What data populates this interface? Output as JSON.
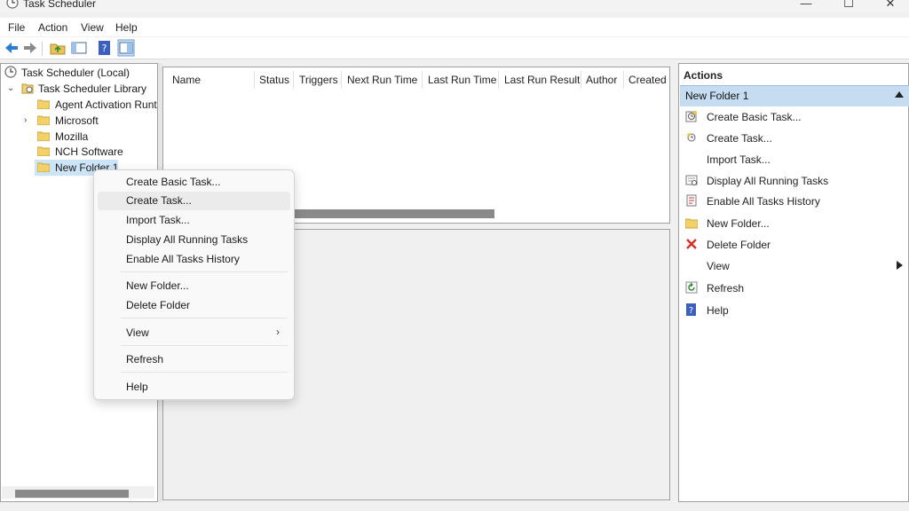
{
  "window": {
    "title": "Task Scheduler"
  },
  "menubar": {
    "items": [
      "File",
      "Action",
      "View",
      "Help"
    ]
  },
  "tree": {
    "root": "Task Scheduler (Local)",
    "library": "Task Scheduler Library",
    "folders": [
      "Agent Activation Runt",
      "Microsoft",
      "Mozilla",
      "NCH Software",
      "New Folder 1"
    ]
  },
  "task_list": {
    "columns": [
      "Name",
      "Status",
      "Triggers",
      "Next Run Time",
      "Last Run Time",
      "Last Run Result",
      "Author",
      "Created"
    ]
  },
  "actions": {
    "title": "Actions",
    "section": "New Folder 1",
    "items": [
      {
        "label": "Create Basic Task...",
        "icon": "create-basic-task-icon"
      },
      {
        "label": "Create Task...",
        "icon": "create-task-icon"
      },
      {
        "label": "Import Task...",
        "icon": ""
      },
      {
        "label": "Display All Running Tasks",
        "icon": "running-tasks-icon"
      },
      {
        "label": "Enable All Tasks History",
        "icon": "history-icon"
      },
      {
        "label": "New Folder...",
        "icon": "folder-icon"
      },
      {
        "label": "Delete Folder",
        "icon": "delete-x-icon"
      },
      {
        "label": "View",
        "icon": ""
      },
      {
        "label": "Refresh",
        "icon": "refresh-icon"
      },
      {
        "label": "Help",
        "icon": "help-icon"
      }
    ]
  },
  "context_menu": {
    "items": [
      "Create Basic Task...",
      "Create Task...",
      "Import Task...",
      "Display All Running Tasks",
      "Enable All Tasks History",
      "New Folder...",
      "Delete Folder",
      "View",
      "Refresh",
      "Help"
    ],
    "highlighted": "Create Task..."
  },
  "colors": {
    "selection": "#cce4f7",
    "actions_header": "#c6dcf0",
    "delete": "#d93025",
    "help": "#3b5fc0"
  }
}
